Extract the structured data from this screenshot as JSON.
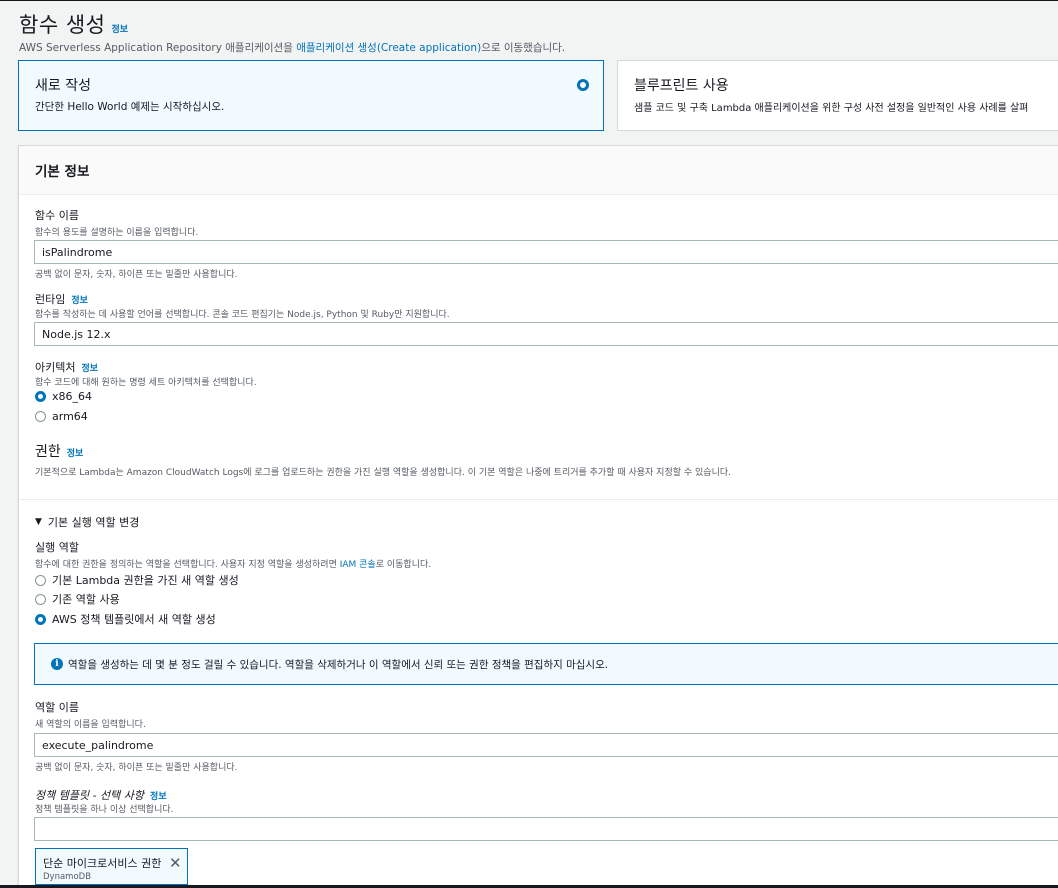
{
  "header": {
    "title": "함수 생성",
    "info_link": "정보",
    "subtitle_prefix": "AWS Serverless Application Repository 애플리케이션을 ",
    "subtitle_link": "애플리케이션 생성(Create application)",
    "subtitle_suffix": "으로 이동했습니다."
  },
  "options": {
    "author_from_scratch": {
      "title": "새로 작성",
      "desc": "간단한 Hello World 예제는 시작하십시오."
    },
    "blueprint": {
      "title": "블루프린트 사용",
      "desc": "샘플 코드 및 구축 Lambda 애플리케이션을 위한 구성 사전 설정을 일반적인 사용 사례를 살펴"
    }
  },
  "basic_info": {
    "title": "기본 정보",
    "function_name": {
      "label": "함수 이름",
      "help": "함수의 용도를 설명하는 이름을 입력합니다.",
      "value": "isPalindrome",
      "constraint": "공백 없이 문자, 숫자, 하이픈 또는 밑줄만 사용합니다."
    },
    "runtime": {
      "label": "런타임",
      "info": "정보",
      "help": "함수를 작성하는 데 사용할 언어를 선택합니다. 콘솔 코드 편집기는 Node.js, Python 및 Ruby만 지원합니다.",
      "value": "Node.js 12.x"
    },
    "architecture": {
      "label": "아키텍처",
      "info": "정보",
      "help": "함수 코드에 대해 원하는 명령 세트 아키텍처를 선택합니다.",
      "options": [
        "x86_64",
        "arm64"
      ],
      "selected": "x86_64"
    },
    "permissions": {
      "title": "권한",
      "info": "정보",
      "help": "기본적으로 Lambda는 Amazon CloudWatch Logs에 로그를 업로드하는 권한을 가진 실행 역할을 생성합니다. 이 기본 역할은 나중에 트리거를 추가할 때 사용자 지정할 수 있습니다."
    },
    "execution_role_toggle": "기본 실행 역할 변경",
    "execution_role": {
      "label": "실행 역할",
      "help_prefix": "함수에 대한 권한을 정의하는 역할을 선택합니다. 사용자 지정 역할을 생성하려면 ",
      "help_link": "IAM 콘솔",
      "help_suffix": "로 이동합니다.",
      "options": [
        "기본 Lambda 권한을 가진 새 역할 생성",
        "기존 역할 사용",
        "AWS 정책 템플릿에서 새 역할 생성"
      ],
      "selected": "AWS 정책 템플릿에서 새 역할 생성"
    },
    "alert": "역할을 생성하는 데 몇 분 정도 걸릴 수 있습니다. 역할을 삭제하거나 이 역할에서 신뢰 또는 권한 정책을 편집하지 마십시오.",
    "role_name": {
      "label": "역할 이름",
      "help": "새 역할의 이름을 입력합니다.",
      "value": "execute_palindrome",
      "constraint": "공백 없이 문자, 숫자, 하이픈 또는 밑줄만 사용합니다."
    },
    "policy_templates": {
      "label": "정책 템플릿 - 선택 사항",
      "info": "정보",
      "help": "정책 템플릿을 하나 이상 선택합니다.",
      "value": "",
      "selected_tag": {
        "label": "단순 마이크로서비스 권한",
        "sub": "DynamoDB"
      }
    }
  }
}
